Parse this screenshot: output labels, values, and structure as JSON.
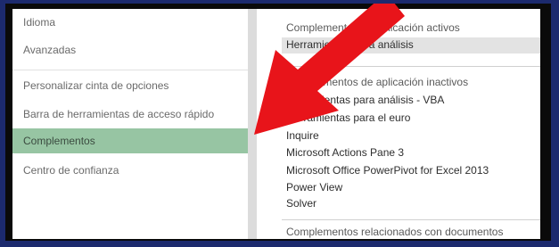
{
  "left_nav": {
    "items": [
      {
        "label": "Idioma"
      },
      {
        "label": "Avanzadas"
      },
      {
        "label": "Personalizar cinta de opciones"
      },
      {
        "label": "Barra de herramientas de acceso rápido"
      },
      {
        "label": "Complementos"
      },
      {
        "label": "Centro de confianza"
      }
    ],
    "selected_index": 4
  },
  "addins": {
    "active_header": "Complementos de aplicación activos",
    "active_item": "Herramientas para análisis",
    "inactive_header": "Complementos de aplicación inactivos",
    "inactive_items": [
      "Herramientas para análisis - VBA",
      "Herramientas para el euro",
      "Inquire",
      "Microsoft Actions Pane 3",
      "Microsoft Office PowerPivot for Excel 2013",
      "Power View",
      "Solver"
    ],
    "documents_header": "Complementos relacionados con documentos"
  },
  "annotation": {
    "arrow_color": "#e8141a",
    "icon": "red-arrow-pointer"
  },
  "colors": {
    "selected_bg": "#97c5a3",
    "outer_background": "#1c2a6e"
  }
}
